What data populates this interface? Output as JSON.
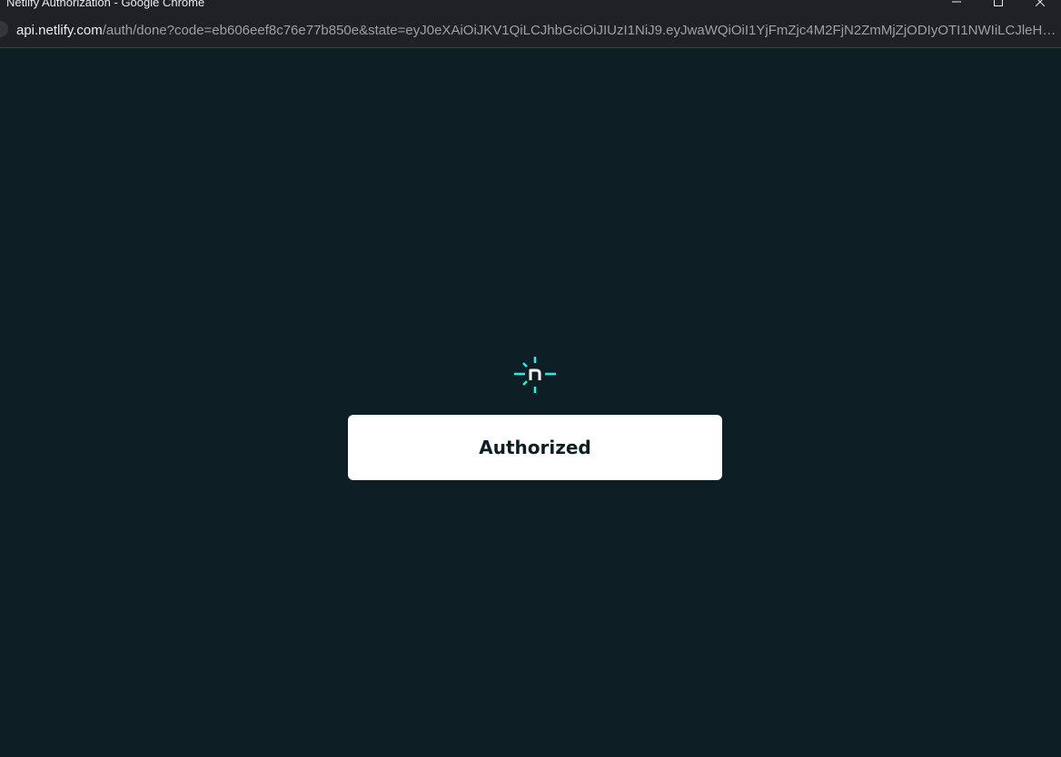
{
  "window": {
    "title": "Netlify Authorization - Google Chrome"
  },
  "addressbar": {
    "host": "api.netlify.com",
    "path": "/auth/done?code=eb606eef8c76e77b850e&state=eyJ0eXAiOiJKV1QiLCJhbGciOiJIUzI1NiJ9.eyJwaWQiOiI1YjFmZjc4M2FjN2ZmMjZjODIyOTI1NWIiLCJleHAi..."
  },
  "page": {
    "status_text": "Authorized"
  },
  "icons": {
    "logo": "netlify-logo",
    "minimize": "minimize-icon",
    "maximize": "maximize-icon",
    "close": "close-icon",
    "site_info": "site-info-icon"
  },
  "colors": {
    "background": "#0e1e25",
    "brand_teal": "#32e6e2",
    "card": "#ffffff",
    "chrome_frame": "#202124"
  }
}
